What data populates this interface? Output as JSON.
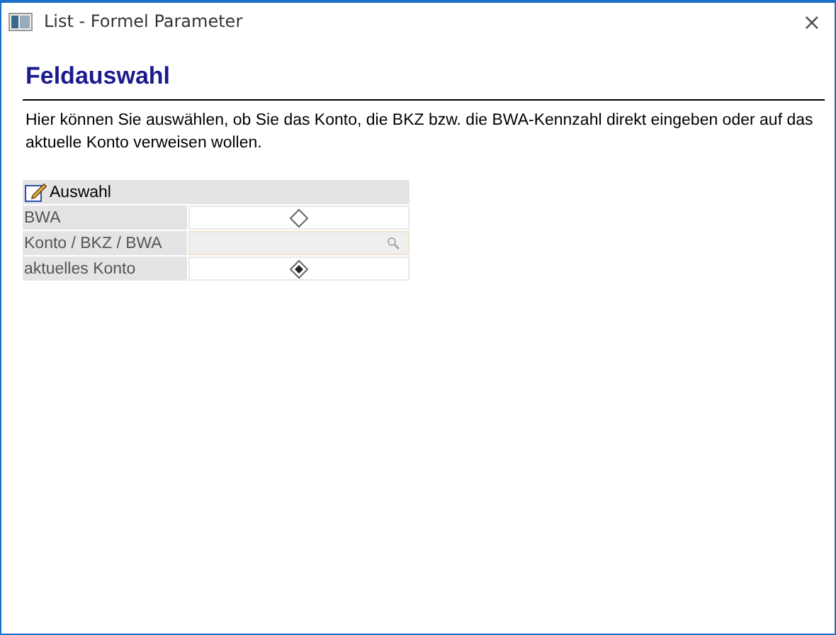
{
  "window": {
    "title": "List - Formel Parameter",
    "close": "×"
  },
  "heading": "Feldauswahl",
  "description": "Hier können Sie auswählen, ob Sie das Konto, die BKZ bzw. die BWA-Kennzahl direkt eingeben oder auf das aktuelle Konto verweisen wollen.",
  "group": {
    "title": "Auswahl",
    "rows": [
      {
        "label": "BWA",
        "kind": "radio",
        "selected": false
      },
      {
        "label": "Konto / BKZ / BWA",
        "kind": "field",
        "disabled": true
      },
      {
        "label": "aktuelles Konto",
        "kind": "radio",
        "selected": true
      }
    ]
  }
}
